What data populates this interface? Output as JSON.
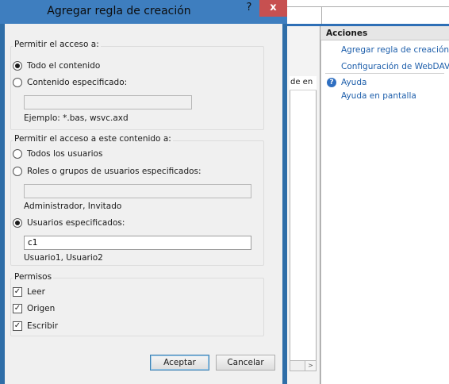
{
  "dialog": {
    "title": "Agregar regla de creación",
    "help_label": "?",
    "close_label": "x",
    "access_group": {
      "legend": "Permitir el acceso a:",
      "options": [
        {
          "label": "Todo el contenido",
          "selected": true
        },
        {
          "label": "Contenido especificado:",
          "selected": false
        }
      ],
      "content_value": "",
      "example": "Ejemplo: *.bas, wsvc.axd"
    },
    "users_group": {
      "legend": "Permitir el acceso a este contenido a:",
      "options": [
        {
          "label": "Todos los usuarios",
          "selected": false
        },
        {
          "label": "Roles o grupos de usuarios especificados:",
          "selected": false
        },
        {
          "label": "Usuarios especificados:",
          "selected": true
        }
      ],
      "roles_value": "",
      "roles_example": "Administrador, Invitado",
      "users_value": "c1",
      "users_example": "Usuario1, Usuario2"
    },
    "permissions_group": {
      "legend": "Permisos",
      "items": [
        {
          "label": "Leer",
          "checked": true
        },
        {
          "label": "Origen",
          "checked": true
        },
        {
          "label": "Escribir",
          "checked": true
        }
      ]
    },
    "ok_label": "Aceptar",
    "cancel_label": "Cancelar"
  },
  "background": {
    "column_header": "de en",
    "actions": {
      "header": "Acciones",
      "links": [
        "Agregar regla de creación...",
        "Configuración de WebDAV..."
      ],
      "help_links": [
        "Ayuda",
        "Ayuda en pantalla"
      ]
    },
    "help_icon": "?",
    "scroll_arrow": ">"
  },
  "colors": {
    "title_bar": "#3e7ebf",
    "close_button": "#c75050",
    "link": "#1e5fab",
    "dialog_face": "#f0f0f0"
  }
}
